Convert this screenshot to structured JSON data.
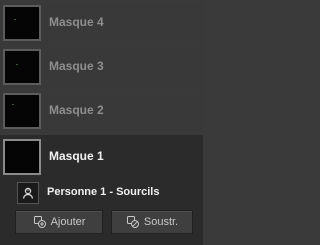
{
  "masks": [
    {
      "label": "Masque 4"
    },
    {
      "label": "Masque 3"
    },
    {
      "label": "Masque 2"
    },
    {
      "label": "Masque 1"
    }
  ],
  "sub_item": {
    "label": "Personne 1 - Sourcils",
    "icon": "person-icon"
  },
  "buttons": {
    "add_label": "Ajouter",
    "subtract_label": "Soustr."
  },
  "colors": {
    "panel": "#3a3a3a",
    "selected": "#2b2b2b",
    "thumb": "#050505"
  }
}
